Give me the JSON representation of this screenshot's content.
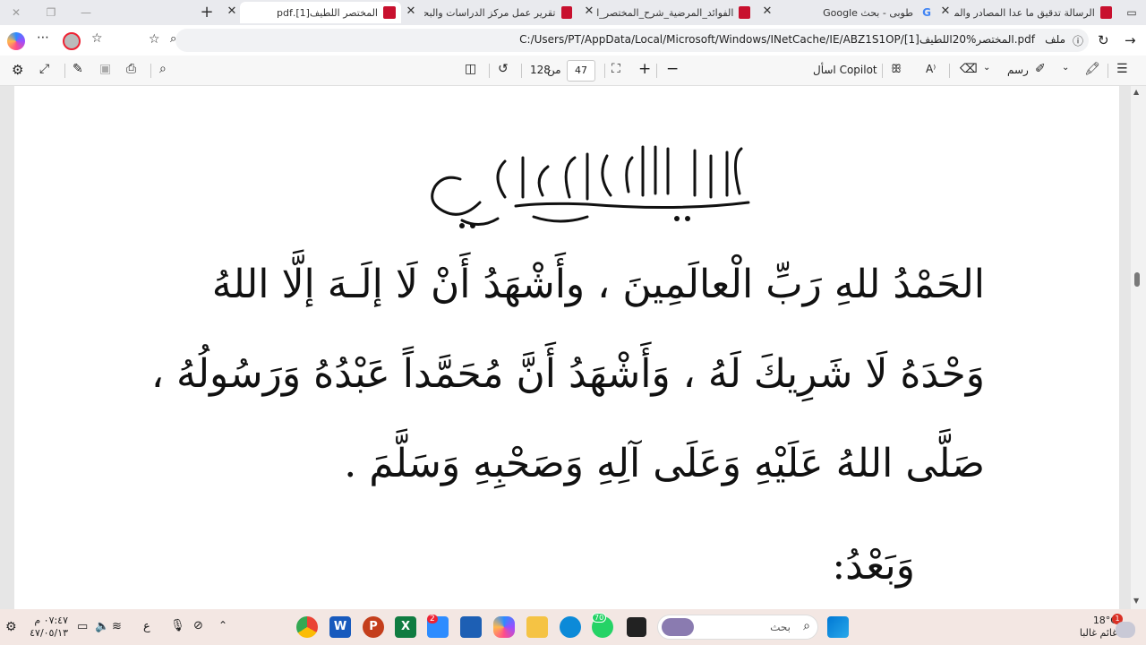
{
  "tabs": [
    {
      "title": "الرسالة تدقيق ما عدا المصادر والمرا",
      "active": false
    },
    {
      "title": "طوبى - بحث Google",
      "active": false
    },
    {
      "title": "الفوائد_المرضية_شرح_المختصر_اللط",
      "active": false
    },
    {
      "title": "تقرير عمل مركز الدراسات والبحوث",
      "active": false
    },
    {
      "title": "المختصر اللطيف[1].pdf",
      "active": true
    }
  ],
  "address": {
    "file_label": "ملف",
    "url": "C:/Users/PT/AppData/Local/Microsoft/Windows/INetCache/IE/ABZ1S1OP/المختصر%20اللطيف[1].pdf"
  },
  "pdf_toolbar": {
    "page_current": "47",
    "of_label": "من",
    "page_total": "128",
    "ask_copilot": "اسأل Copilot",
    "draw_label": "رسم"
  },
  "document": {
    "lines": [
      "الحَمْدُ للهِ رَبِّ الْعالَمِينَ ، وأَشْهَدُ أَنْ لَا إلَـهَ إلَّا اللهُ",
      "وَحْدَهُ لَا شَرِيكَ لَهُ ، وَأَشْهَدُ أَنَّ مُحَمَّداً عَبْدُهُ وَرَسُولُهُ ،",
      "صَلَّى اللهُ عَلَيْهِ وَعَلَى آلِهِ وَصَحْبِهِ وَسَلَّمَ .",
      "وَبَعْدُ:"
    ]
  },
  "taskbar": {
    "search_placeholder": "بحث",
    "weather_temp": "18°C",
    "weather_desc": "غائم غالبا",
    "time": "٠٧:٤٧ م",
    "date": "٤٧/٠٥/١٣",
    "lang": "ع",
    "notif_badge": "1",
    "zoom_badge": "2",
    "whatsapp_badge": "70"
  }
}
